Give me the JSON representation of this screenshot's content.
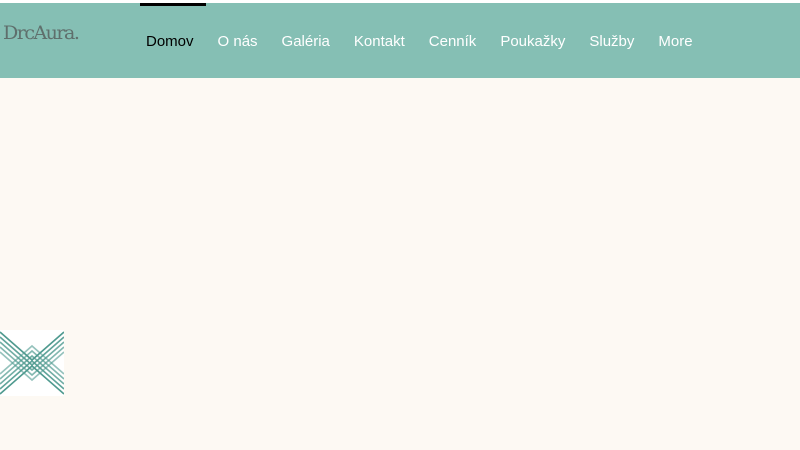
{
  "logo": {
    "text": "DrcAura."
  },
  "nav": {
    "items": [
      {
        "label": "Domov",
        "active": true
      },
      {
        "label": "O nás",
        "active": false
      },
      {
        "label": "Galéria",
        "active": false
      },
      {
        "label": "Kontakt",
        "active": false
      },
      {
        "label": "Cenník",
        "active": false
      },
      {
        "label": "Poukažky",
        "active": false
      },
      {
        "label": "Služby",
        "active": false
      },
      {
        "label": "More",
        "active": false
      }
    ]
  },
  "colors": {
    "header_bg": "#85bfb4",
    "page_bg": "#fdf9f3",
    "nav_text": "#ffffff",
    "nav_active_text": "#000000",
    "pattern_dark": "#4f9a8f",
    "pattern_light": "#ffffff"
  },
  "icons": {
    "decorative_pattern": "chevron-pattern-icon"
  }
}
